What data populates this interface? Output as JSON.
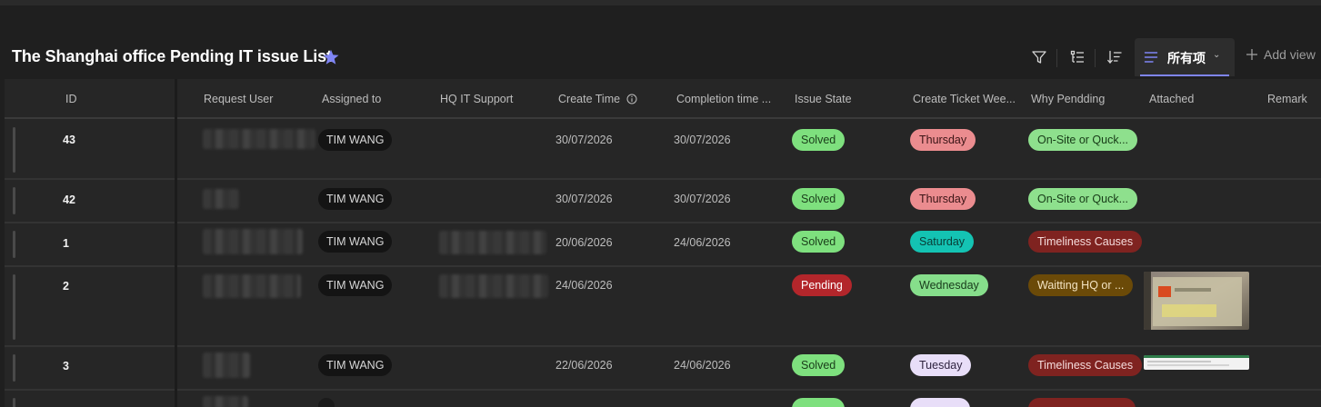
{
  "list_title": "The Shanghai office Pending IT issue List",
  "toolbar": {
    "view_label": "所有项",
    "add_view_label": "Add view"
  },
  "columns": {
    "id": "ID",
    "request_user": "Request User",
    "assigned_to": "Assigned to",
    "hq_it_support": "HQ IT Support",
    "create_time": "Create Time",
    "completion_time": "Completion time ...",
    "issue_state": "Issue State",
    "create_ticket_week": "Create Ticket Wee...",
    "why_pending": "Why Pendding",
    "attached": "Attached",
    "remark": "Remark"
  },
  "rows": [
    {
      "id": "43",
      "assigned_to": "TIM WANG",
      "create_time": "30/07/2026",
      "completion_time": "30/07/2026",
      "issue_state": "Solved",
      "week_day": "Thursday",
      "why_pending": "On-Site or Quck..."
    },
    {
      "id": "42",
      "assigned_to": "TIM WANG",
      "create_time": "30/07/2026",
      "completion_time": "30/07/2026",
      "issue_state": "Solved",
      "week_day": "Thursday",
      "why_pending": "On-Site or Quck..."
    },
    {
      "id": "1",
      "assigned_to": "TIM WANG",
      "create_time": "20/06/2026",
      "completion_time": "24/06/2026",
      "issue_state": "Solved",
      "week_day": "Saturday",
      "why_pending": "Timeliness Causes"
    },
    {
      "id": "2",
      "assigned_to": "TIM WANG",
      "create_time": "24/06/2026",
      "completion_time": "",
      "issue_state": "Pending",
      "week_day": "Wednesday",
      "why_pending": "Waitting HQ or ..."
    },
    {
      "id": "3",
      "assigned_to": "TIM WANG",
      "create_time": "22/06/2026",
      "completion_time": "24/06/2026",
      "issue_state": "Solved",
      "week_day": "Tuesday",
      "why_pending": "Timeliness Causes"
    }
  ],
  "colors": {
    "solved_bg": "#7ee07e",
    "solved_fg": "#1a3d1a",
    "pending_bg": "#b3262b",
    "pending_fg": "#ffffff",
    "thursday_bg": "#eb8c8f",
    "thursday_fg": "#3b1416",
    "saturday_bg": "#14c3b3",
    "saturday_fg": "#0a3b35",
    "wednesday_bg": "#86de8b",
    "wednesday_fg": "#183b1b",
    "tuesday_bg": "#e8def8",
    "tuesday_fg": "#2f2440",
    "onsite_bg": "#8ee08d",
    "onsite_fg": "#173b17",
    "timeliness_bg": "#7f2320",
    "timeliness_fg": "#f5dcdc",
    "waiting_bg": "#6b4a08",
    "waiting_fg": "#f3e3c2",
    "accent": "#7f85f5"
  },
  "icons": {
    "favorite": "star-icon",
    "filter": "filter-icon",
    "group": "group-list-icon",
    "sort": "sort-icon",
    "view": "list-view-icon",
    "add": "plus-icon",
    "info": "info-icon"
  }
}
